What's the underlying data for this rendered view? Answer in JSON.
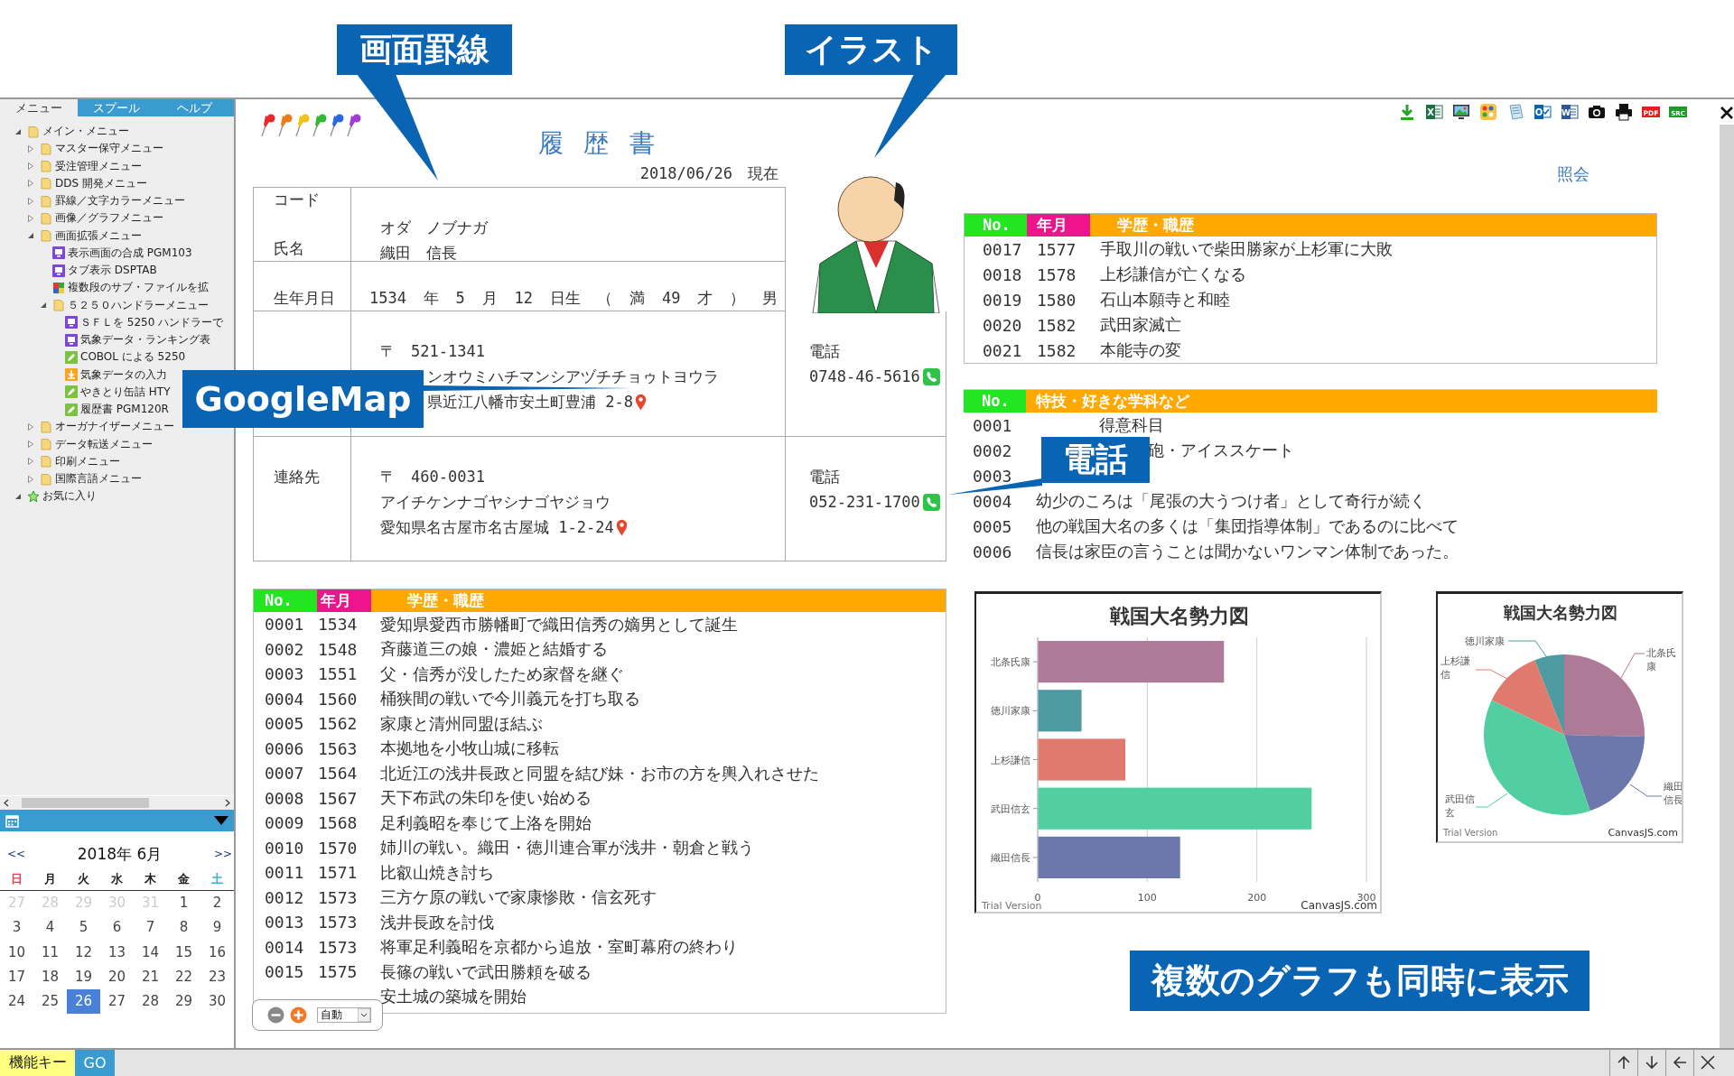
{
  "sidebar": {
    "tabs": [
      {
        "label": "メニュー",
        "selected": true
      },
      {
        "label": "スプール",
        "selected": false
      },
      {
        "label": "ヘルプ",
        "selected": false
      }
    ],
    "tree": [
      {
        "label": "メイン・メニュー",
        "kind": "folder",
        "expanded": true,
        "children": [
          {
            "label": "マスター保守メニュー",
            "kind": "folder",
            "expanded": false
          },
          {
            "label": "受注管理メニュー",
            "kind": "folder",
            "expanded": false
          },
          {
            "label": "DDS 開発メニュー",
            "kind": "folder",
            "expanded": false
          },
          {
            "label": "罫線／文字カラーメニュー",
            "kind": "folder",
            "expanded": false
          },
          {
            "label": "画像／グラフメニュー",
            "kind": "folder",
            "expanded": false
          },
          {
            "label": "画面拡張メニュー",
            "kind": "folder",
            "expanded": true,
            "children": [
              {
                "label": "表示画面の合成 PGM103",
                "kind": "screen"
              },
              {
                "label": "タブ表示 DSPTAB",
                "kind": "screen"
              },
              {
                "label": "複数段のサブ・ファイルを拡",
                "kind": "multi"
              },
              {
                "label": "５２５０ハンドラーメニュー",
                "kind": "folder",
                "expanded": true,
                "children": [
                  {
                    "label": "ＳＦＬを 5250 ハンドラーで",
                    "kind": "screen"
                  },
                  {
                    "label": "気象データ・ランキング表",
                    "kind": "screen"
                  },
                  {
                    "label": "COBOL による 5250",
                    "kind": "edit"
                  },
                  {
                    "label": "気象データの入力",
                    "kind": "download"
                  },
                  {
                    "label": "やきとり缶詰 HTY",
                    "kind": "edit"
                  },
                  {
                    "label": "履歴書 PGM120R",
                    "kind": "edit"
                  }
                ]
              }
            ]
          },
          {
            "label": "オーガナイザーメニュー",
            "kind": "folder",
            "expanded": false
          },
          {
            "label": "データ転送メニュー",
            "kind": "folder",
            "expanded": false
          },
          {
            "label": "印刷メニュー",
            "kind": "folder",
            "expanded": false
          },
          {
            "label": "国際言語メニュー",
            "kind": "folder",
            "expanded": false
          }
        ]
      },
      {
        "label": "お気に入り",
        "kind": "star",
        "expanded": true
      }
    ]
  },
  "calendar": {
    "prev": "<<",
    "title": "2018年 6月",
    "next": ">>",
    "weekdays": [
      "日",
      "月",
      "火",
      "水",
      "木",
      "金",
      "土"
    ],
    "weeks": [
      [
        {
          "day": "27",
          "muted": true,
          "selected": false
        },
        {
          "day": "28",
          "muted": true,
          "selected": false
        },
        {
          "day": "29",
          "muted": true,
          "selected": false
        },
        {
          "day": "30",
          "muted": true,
          "selected": false
        },
        {
          "day": "31",
          "muted": true,
          "selected": false
        },
        {
          "day": "1",
          "muted": false,
          "selected": false
        },
        {
          "day": "2",
          "muted": false,
          "selected": false
        }
      ],
      [
        {
          "day": "3",
          "muted": false,
          "selected": false
        },
        {
          "day": "4",
          "muted": false,
          "selected": false
        },
        {
          "day": "5",
          "muted": false,
          "selected": false
        },
        {
          "day": "6",
          "muted": false,
          "selected": false
        },
        {
          "day": "7",
          "muted": false,
          "selected": false
        },
        {
          "day": "8",
          "muted": false,
          "selected": false
        },
        {
          "day": "9",
          "muted": false,
          "selected": false
        }
      ],
      [
        {
          "day": "10",
          "muted": false,
          "selected": false
        },
        {
          "day": "11",
          "muted": false,
          "selected": false
        },
        {
          "day": "12",
          "muted": false,
          "selected": false
        },
        {
          "day": "13",
          "muted": false,
          "selected": false
        },
        {
          "day": "14",
          "muted": false,
          "selected": false
        },
        {
          "day": "15",
          "muted": false,
          "selected": false
        },
        {
          "day": "16",
          "muted": false,
          "selected": false
        }
      ],
      [
        {
          "day": "17",
          "muted": false,
          "selected": false
        },
        {
          "day": "18",
          "muted": false,
          "selected": false
        },
        {
          "day": "19",
          "muted": false,
          "selected": false
        },
        {
          "day": "20",
          "muted": false,
          "selected": false
        },
        {
          "day": "21",
          "muted": false,
          "selected": false
        },
        {
          "day": "22",
          "muted": false,
          "selected": false
        },
        {
          "day": "23",
          "muted": false,
          "selected": false
        }
      ],
      [
        {
          "day": "24",
          "muted": false,
          "selected": false
        },
        {
          "day": "25",
          "muted": false,
          "selected": false
        },
        {
          "day": "26",
          "muted": false,
          "selected": true
        },
        {
          "day": "27",
          "muted": false,
          "selected": false
        },
        {
          "day": "28",
          "muted": false,
          "selected": false
        },
        {
          "day": "29",
          "muted": false,
          "selected": false
        },
        {
          "day": "30",
          "muted": false,
          "selected": false
        }
      ]
    ]
  },
  "toolbar": [
    {
      "kind": "download"
    },
    {
      "kind": "excel",
      "text": "X"
    },
    {
      "kind": "image"
    },
    {
      "kind": "palette"
    },
    {
      "kind": "notepad"
    },
    {
      "kind": "outlook",
      "text": "O"
    },
    {
      "kind": "word",
      "text": "W"
    },
    {
      "kind": "camera"
    },
    {
      "kind": "printer"
    },
    {
      "kind": "pdf",
      "text": "PDF"
    },
    {
      "kind": "src",
      "text": "SRC"
    }
  ],
  "document": {
    "title": "履 歴 書",
    "date": "2018/06/26　現在",
    "inquiry_link": "照会",
    "form": {
      "name_row": {
        "labels": [
          "コード",
          "氏名"
        ],
        "kana": "オダ　ノブナガ",
        "name": "織田　信長"
      },
      "birth_row": {
        "label": "生年月日",
        "parts": [
          "1534",
          "年",
          "5",
          "月",
          "12",
          "日生",
          "（",
          "満",
          "49",
          "才",
          "）",
          "男"
        ]
      },
      "addresses": [
        {
          "postal": "〒　521-1341",
          "kana": "ンオウミハチマンシアヅチチョゥトヨウラ",
          "address": "県近江八幡市安土町豊浦 2-8",
          "phone_label": "電話",
          "phone": "0748-46-5616"
        },
        {
          "label": "連絡先",
          "postal": "〒　460-0031",
          "kana": "アイチケンナゴヤシナゴヤジョウ",
          "address": "愛知県名古屋市名古屋城 1-2-24",
          "phone_label": "電話",
          "phone": "052-231-1700"
        }
      ]
    },
    "history_left": {
      "columns": [
        "No.",
        "年月",
        "学歴・職歴"
      ],
      "rows": [
        {
          "no": "0001",
          "date": "1534",
          "text": "愛知県愛西市勝幡町で織田信秀の嫡男として誕生"
        },
        {
          "no": "0002",
          "date": "1548",
          "text": "斉藤道三の娘・濃姫と結婚する"
        },
        {
          "no": "0003",
          "date": "1551",
          "text": "父・信秀が没したため家督を継ぐ"
        },
        {
          "no": "0004",
          "date": "1560",
          "text": "桶狭間の戦いで今川義元を打ち取る"
        },
        {
          "no": "0005",
          "date": "1562",
          "text": "家康と清州同盟ほ結ぶ"
        },
        {
          "no": "0006",
          "date": "1563",
          "text": "本拠地を小牧山城に移転"
        },
        {
          "no": "0007",
          "date": "1564",
          "text": "北近江の浅井長政と同盟を結び妹・お市の方を輿入れさせた"
        },
        {
          "no": "0008",
          "date": "1567",
          "text": "天下布武の朱印を使い始める"
        },
        {
          "no": "0009",
          "date": "1568",
          "text": "足利義昭を奉じて上洛を開始"
        },
        {
          "no": "0010",
          "date": "1570",
          "text": "姉川の戦い。織田・徳川連合軍が浅井・朝倉と戦う"
        },
        {
          "no": "0011",
          "date": "1571",
          "text": "比叡山焼き討ち"
        },
        {
          "no": "0012",
          "date": "1573",
          "text": "三方ケ原の戦いで家康惨敗・信玄死す"
        },
        {
          "no": "0013",
          "date": "1573",
          "text": "浅井長政を討伐"
        },
        {
          "no": "0014",
          "date": "1573",
          "text": "将軍足利義昭を京都から追放・室町幕府の終わり"
        },
        {
          "no": "0015",
          "date": "1575",
          "text": "長篠の戦いで武田勝頼を破る"
        },
        {
          "text": "安土城の築城を開始"
        }
      ]
    },
    "zoom_control": {
      "mode": "自動"
    },
    "history_right": {
      "columns": [
        "No.",
        "年月",
        "学歴・職歴"
      ],
      "rows": [
        {
          "no": "0017",
          "date": "1577",
          "text": "手取川の戦いで柴田勝家が上杉軍に大敗"
        },
        {
          "no": "0018",
          "date": "1578",
          "text": "上杉謙信が亡くなる"
        },
        {
          "no": "0019",
          "date": "1580",
          "text": "石山本願寺と和睦"
        },
        {
          "no": "0020",
          "date": "1582",
          "text": "武田家滅亡"
        },
        {
          "no": "0021",
          "date": "1582",
          "text": "本能寺の変"
        }
      ]
    },
    "skills": {
      "columns": [
        "No.",
        "特技・好きな学科など"
      ],
      "rows": [
        {
          "no": "0001",
          "kind": "heading",
          "text": "得意科目"
        },
        {
          "no": "0002",
          "kind": "partial",
          "text": "砲・アイススケート"
        },
        {
          "no": "0003",
          "kind": "item"
        },
        {
          "no": "0004",
          "kind": "item",
          "text": "幼少のころは「尾張の大うつけ者」として奇行が続く"
        },
        {
          "no": "0005",
          "kind": "item",
          "text": "他の戦国大名の多くは「集団指導体制」であるのに比べて"
        },
        {
          "no": "0006",
          "kind": "item",
          "text": "信長は家臣の言うことは聞かないワンマン体制であった。"
        }
      ]
    },
    "bar_chart": {
      "chart_data": {
        "type": "bar",
        "orientation": "horizontal",
        "title": "戦国大名勢力図",
        "categories": [
          "北条氏康",
          "徳川家康",
          "上杉謙信",
          "武田信玄",
          "織田信長"
        ],
        "stacked": true,
        "xlim": [
          0,
          300
        ],
        "xticks": [
          0,
          100,
          200,
          300
        ],
        "series": [
          {
            "color": "#ad7a97",
            "values": [
              170,
              null,
              null,
              null,
              null
            ]
          },
          {
            "color": "#4d9aa0",
            "values": [
              null,
              40,
              null,
              null,
              null
            ]
          },
          {
            "color": "#e07a6e",
            "values": [
              null,
              null,
              80,
              null,
              null
            ]
          },
          {
            "color": "#52cfa0",
            "values": [
              null,
              null,
              null,
              250,
              null
            ]
          },
          {
            "color": "#6c78ac",
            "values": [
              null,
              null,
              null,
              null,
              130
            ]
          }
        ]
      },
      "trial": "Trial Version",
      "credit": "CanvasJS.com"
    },
    "pie_chart": {
      "title": "戦国大名勢力図",
      "slices": [
        {
          "label": [
            "徳川家康"
          ],
          "color": "#4d9aa0"
        },
        {
          "label": [
            "北条氏",
            "康"
          ],
          "color": "#ad7a97"
        },
        {
          "label": [
            "上杉謙",
            "信"
          ],
          "color": "#e07a6e"
        },
        {
          "label": [
            "織田",
            "信長"
          ],
          "color": "#6c78ac"
        },
        {
          "label": [
            "武田信",
            "玄"
          ],
          "color": "#52cfa0"
        }
      ],
      "trial": "Trial Version",
      "credit": "CanvasJS.com"
    }
  },
  "status_bar": {
    "keys": [
      {
        "label": "機能キー",
        "kind": "function"
      },
      {
        "label": "GO",
        "kind": "go"
      }
    ]
  },
  "callouts": [
    {
      "text": "画面罫線"
    },
    {
      "text": "イラスト"
    },
    {
      "text": "GoogleMap"
    },
    {
      "text": "電話"
    },
    {
      "text": "複数のグラフも同時に表示"
    }
  ]
}
